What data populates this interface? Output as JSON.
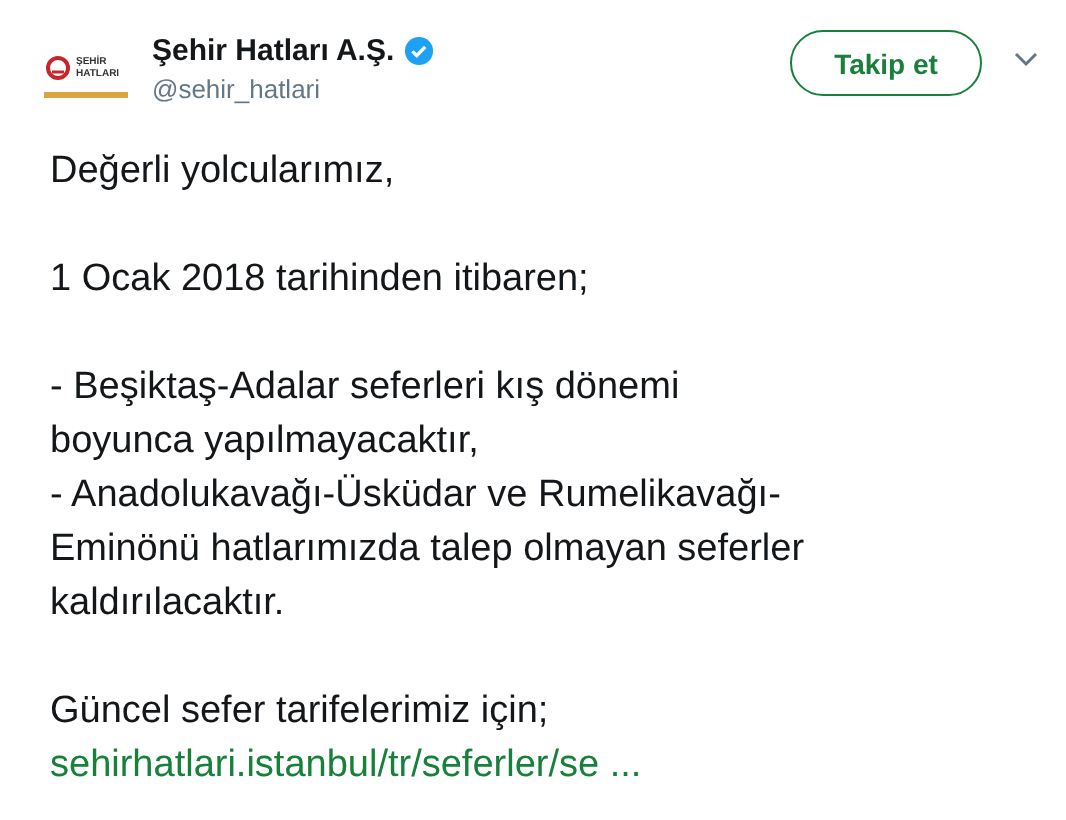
{
  "account": {
    "logo_text": [
      "ŞEHİR",
      "HATLARI"
    ],
    "name": "Şehir Hatları A.Ş.",
    "verified": true,
    "handle": "@sehir_hatlari"
  },
  "follow_button": {
    "label": "Takip et"
  },
  "tweet": {
    "paragraphs": [
      "Değerli yolcularımız,",
      "1 Ocak 2018 tarihinden itibaren;",
      "- Beşiktaş-Adalar seferleri kış dönemi\nboyunca yapılmayacaktır,\n- Anadolukavağı-Üsküdar ve Rumelikavağı-\nEminönü hatlarımızda talep olmayan seferler\nkaldırılacaktır.",
      "Güncel sefer tarifelerimiz için;"
    ],
    "link": "sehirhatlari.istanbul/tr/seferler/se ..."
  }
}
